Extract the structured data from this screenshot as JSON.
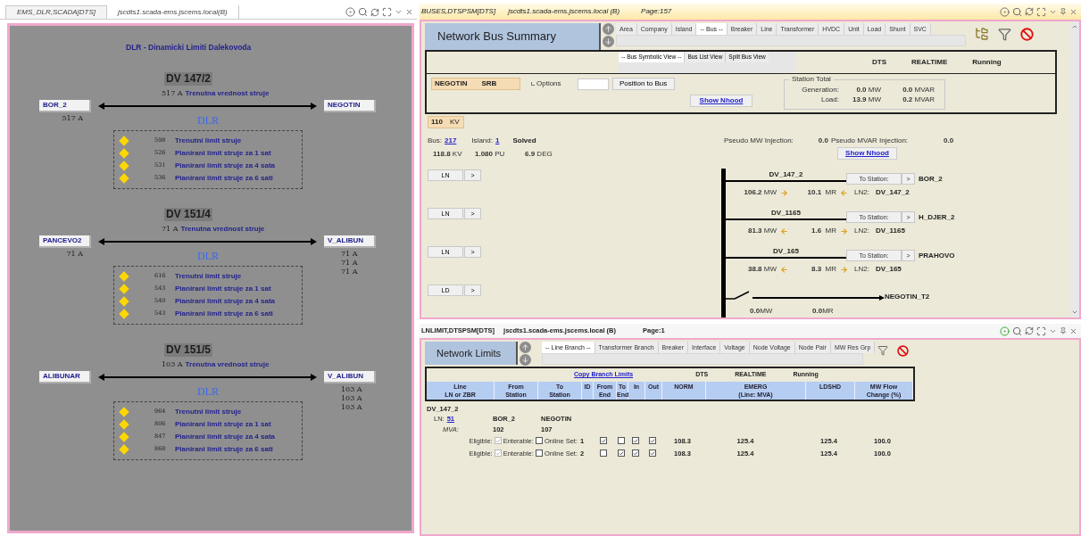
{
  "dlr_panel": {
    "tabs": [
      {
        "label": "EMS_DLR,SCADA[DTS]",
        "selected": true
      },
      {
        "label": "jscdts1.scada-ems.jscems.local(B)",
        "selected": false
      }
    ],
    "active": false,
    "heading": "DLR - Dinamicki Limiti Dalekovoda",
    "lines": [
      {
        "name": "DV 147/2",
        "current": "517 A",
        "current_label": "Trenutna vrednost struje",
        "from_station": "BOR_2",
        "to_station": "NEGOTIN",
        "from_readings": [
          "517 A"
        ],
        "dlr_label": "DLR",
        "limits": [
          {
            "value": "598",
            "label": "Trenutni limit struje"
          },
          {
            "value": "526",
            "label": "Planirani limit struje za 1 sat"
          },
          {
            "value": "531",
            "label": "Planirani limit struje za 4 sata"
          },
          {
            "value": "536",
            "label": "Planirani limit struje za 6 sati"
          }
        ]
      },
      {
        "name": "DV 151/4",
        "current": "71 A",
        "current_label": "Trenutna vrednost struje",
        "from_station": "PANCEVO2",
        "to_station": "V_ALIBUN",
        "from_readings": [
          "71 A"
        ],
        "to_readings": [
          "71 A",
          "71 A",
          "71 A"
        ],
        "dlr_label": "DLR",
        "limits": [
          {
            "value": "616",
            "label": "Trenutni limit struje"
          },
          {
            "value": "543",
            "label": "Planirani limit struje za 1 sat"
          },
          {
            "value": "540",
            "label": "Planirani limit struje za 4 sata"
          },
          {
            "value": "543",
            "label": "Planirani limit struje za 6 sati"
          }
        ]
      },
      {
        "name": "DV 151/5",
        "current": "103 A",
        "current_label": "Trenutna vrednost struje",
        "from_station": "ALIBUNAR",
        "to_station": "V_ALIBUN",
        "to_readings": [
          "103 A",
          "103 A",
          "103 A"
        ],
        "dlr_label": "DLR",
        "limits": [
          {
            "value": "964",
            "label": "Trenutni limit struje"
          },
          {
            "value": "806",
            "label": "Planirani limit struje za 1 sat"
          },
          {
            "value": "847",
            "label": "Planirani limit struje za 4 sata"
          },
          {
            "value": "868",
            "label": "Planirani limit struje za 6 sati"
          }
        ]
      }
    ]
  },
  "bus_summary": {
    "title_bar": {
      "name": "BUSES,DTSPSM[DTS]",
      "host": "jscdts1.scada-ems.jscems.local (B)",
      "page": "Page:157",
      "active": false
    },
    "heading": "Network Bus Summary",
    "tabs": [
      {
        "label": "Area",
        "selected": false
      },
      {
        "label": "Company",
        "selected": false
      },
      {
        "label": "Island",
        "selected": false
      },
      {
        "label": "-- Bus --",
        "selected": true
      },
      {
        "label": "Breaker",
        "selected": false
      },
      {
        "label": "Line",
        "selected": false
      },
      {
        "label": "Transformer",
        "selected": false
      },
      {
        "label": "HVDC",
        "selected": false
      },
      {
        "label": "Unit",
        "selected": false
      },
      {
        "label": "Load",
        "selected": false
      },
      {
        "label": "Shunt",
        "selected": false
      },
      {
        "label": "SVC",
        "selected": false
      }
    ],
    "sub_tabs": [
      {
        "label": "-- Bus Symbolic View --",
        "selected": true
      },
      {
        "label": "Bus List View",
        "selected": false
      },
      {
        "label": "Split Bus View",
        "selected": false
      }
    ],
    "status": [
      "DTS",
      "REALTIME",
      "Running"
    ],
    "station": [
      "NEGOTIN",
      "SRB"
    ],
    "options": "Options",
    "position_button": "Position to Bus",
    "show_nhood": "Show Nhood",
    "station_total": {
      "legend": "Station Total",
      "rows": [
        {
          "label": "Generation:",
          "mw": "**0.0** MW",
          "mvar": "**0.0** MVAR"
        },
        {
          "label": "Load:",
          "mw": "**13.9** MW",
          "mvar": "**0.2** MVAR"
        }
      ]
    },
    "voltage": [
      "110",
      "KV"
    ],
    "bus_info": {
      "bus_label": "Bus:",
      "bus": "217",
      "island_label": "Island:",
      "island": "1",
      "status": "Solved",
      "kv": "**118.8** KV",
      "pu": "**1.080** PU",
      "deg": "**6.9** DEG"
    },
    "pseudo": {
      "mw_label": "Pseudo MW Injection:",
      "mw": "0.0",
      "mvar_label": "Pseudo MVAR Injection:",
      "mvar": "0.0",
      "show_nhood": "Show Nhood"
    },
    "branches": [
      {
        "kind": "line",
        "button": "LN",
        "next": ">",
        "name": "DV_147_2",
        "mw": "**106.2** MW",
        "mw_right": true,
        "mr": "**10.1**  MR",
        "mr_right": false,
        "to_station_label": "To Station:",
        "station_next": ">",
        "station": "BOR_2",
        "ln2_label": "LN2:",
        "ln2": "DV_147_2"
      },
      {
        "kind": "line",
        "button": "LN",
        "next": ">",
        "name": "DV_1165",
        "mw": "**81.3** MW",
        "mw_right": false,
        "mr": "**1.6**  MR",
        "mr_right": true,
        "to_station_label": "To Station:",
        "station_next": ">",
        "station": "H_DJER_2",
        "ln2_label": "LN2:",
        "ln2": "DV_1165"
      },
      {
        "kind": "line",
        "button": "LN",
        "next": ">",
        "name": "DV_165",
        "mw": "**38.8** MW",
        "mw_right": false,
        "mr": "**8.3**  MR",
        "mr_right": true,
        "to_station_label": "To Station:",
        "station_next": ">",
        "station": "PRAHOVO",
        "ln2_label": "LN2:",
        "ln2": "DV_165"
      },
      {
        "kind": "load",
        "button": "LD",
        "next": ">",
        "name": "NEGOTIN_T2",
        "mw": "**0.0**MW",
        "mr": "**0.0**MR",
        "closed": false
      }
    ]
  },
  "network_limits": {
    "title_bar": {
      "name": "LNLIMIT,DTSPSM[DTS]",
      "host": "jscdts1.scada-ems.jscems.local (B)",
      "page": "Page:1",
      "active": true
    },
    "heading": "Network Limits",
    "tabs": [
      {
        "label": "-- Line Branch --",
        "selected": true
      },
      {
        "label": "Transformer Branch",
        "selected": false
      },
      {
        "label": "Breaker",
        "selected": false
      },
      {
        "label": "Interface",
        "selected": false
      },
      {
        "label": "Voltage",
        "selected": false
      },
      {
        "label": "Node Voltage",
        "selected": false
      },
      {
        "label": "Node Pair",
        "selected": false
      },
      {
        "label": "MW Res Grp",
        "selected": false
      }
    ],
    "copy_link": "Copy Branch Limits",
    "status": [
      "DTS",
      "REALTIME",
      "Running"
    ],
    "columns": [
      {
        "lines": [
          "Line",
          "LN or ZBR"
        ]
      },
      {
        "lines": [
          "From",
          "Station"
        ]
      },
      {
        "lines": [
          "To",
          "Station"
        ]
      },
      {
        "lines": [
          "ID"
        ]
      },
      {
        "lines": [
          "From",
          "End"
        ]
      },
      {
        "lines": [
          "To",
          "End"
        ]
      },
      {
        "lines": [
          "In"
        ]
      },
      {
        "lines": [
          "Out"
        ]
      },
      {
        "lines": [
          "NORM"
        ]
      },
      {
        "lines": [
          "EMERG",
          "(Line: MVA)"
        ]
      },
      {
        "lines": [
          "LDSHD"
        ]
      },
      {
        "lines": [
          "MW Flow",
          "Change (%)"
        ]
      }
    ],
    "groups": [
      {
        "name": "DV_147_2",
        "ln_label": "LN:",
        "ln": "51",
        "from_station": "BOR_2",
        "to_station": "NEGOTIN",
        "mva_label": "MVA:",
        "mva_from": "102",
        "mva_to": "107",
        "rows": [
          {
            "eligible_label": "Eligible:",
            "eligible": true,
            "enterable_label": "Enterable:",
            "enterable": false,
            "online_label": "Online Set:",
            "id": "1",
            "from_end": true,
            "to_end": false,
            "in": true,
            "out": true,
            "norm": "108.3",
            "emerg": "125.4",
            "ldshd": "125.4",
            "mw_flow": "100.0"
          },
          {
            "eligible_label": "Eligible:",
            "eligible": true,
            "enterable_label": "Enterable:",
            "enterable": false,
            "online_label": "Online Set:",
            "id": "2",
            "from_end": false,
            "to_end": true,
            "in": true,
            "out": true,
            "norm": "108.3",
            "emerg": "125.4",
            "ldshd": "125.4",
            "mw_flow": "100.0"
          }
        ]
      }
    ]
  }
}
